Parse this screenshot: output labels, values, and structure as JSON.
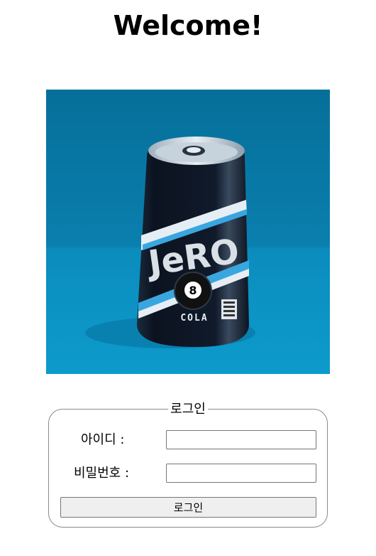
{
  "page": {
    "title": "Welcome!"
  },
  "hero_image": {
    "description_icon": "cola-can-image",
    "brand_text": "JeRO",
    "product_text": "COLA",
    "ball_number": "8"
  },
  "login": {
    "legend": "로그인",
    "id_label": "아이디 :",
    "id_value": "",
    "password_label": "비밀번호 :",
    "password_value": "",
    "submit_label": "로그인"
  },
  "colors": {
    "background": "#ffffff",
    "image_bg": "#0a7fae",
    "can_body": "#0d1522",
    "accent_blue": "#3aa6e0",
    "fieldset_border": "#8a8a8a",
    "button_bg": "#efefef"
  }
}
